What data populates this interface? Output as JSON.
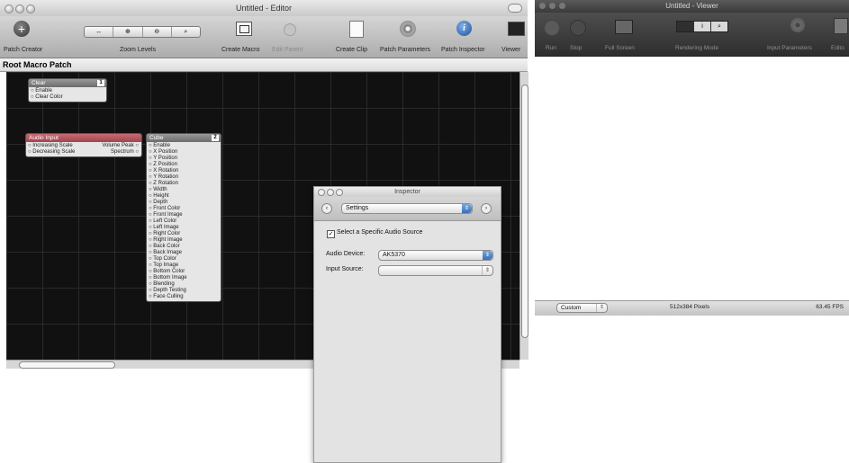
{
  "editor": {
    "title": "Untitled - Editor",
    "toolbar": {
      "patch_creator": "Patch Creator",
      "zoom_levels": "Zoom Levels",
      "create_macro": "Create Macro",
      "edit_parent": "Edit Parent",
      "create_clip": "Create Clip",
      "patch_parameters": "Patch Parameters",
      "patch_inspector": "Patch Inspector",
      "viewer": "Viewer"
    },
    "path": "Root Macro Patch",
    "patches": {
      "clear": {
        "title": "Clear",
        "number": "1",
        "inputs": [
          "Enable",
          "Clear Color"
        ]
      },
      "audio_input": {
        "title": "Audio Input",
        "inputs": [
          "Increasing Scale",
          "Decreasing Scale"
        ],
        "outputs": [
          "Volume Peak",
          "Spectrum"
        ]
      },
      "cube": {
        "title": "Cube",
        "number": "2",
        "inputs": [
          "Enable",
          "X Position",
          "Y Position",
          "Z Position",
          "X Rotation",
          "Y Rotation",
          "Z Rotation",
          "Width",
          "Height",
          "Depth",
          "Front Color",
          "Front Image",
          "Left Color",
          "Left Image",
          "Right Color",
          "Right Image",
          "Back Color",
          "Back Image",
          "Top Color",
          "Top Image",
          "Bottom Color",
          "Bottom Image",
          "Blending",
          "Depth Testing",
          "Face Culling"
        ]
      }
    }
  },
  "inspector": {
    "title": "Inspector",
    "mode": "Settings",
    "checkbox_label": "Select a Specific Audio Source",
    "audio_device_label": "Audio Device:",
    "audio_device_value": "AK5370",
    "input_source_label": "Input Source:",
    "input_source_value": ""
  },
  "viewer": {
    "title": "Untitled - Viewer",
    "toolbar": {
      "run": "Run",
      "stop": "Stop",
      "full_screen": "Full Screen",
      "rendering_mode": "Rendering Mode",
      "input_parameters": "Input Parameters",
      "editor": "Edito"
    },
    "size_preset": "Custom",
    "resolution": "512x384 Pixels",
    "fps": "63.45 FPS"
  }
}
